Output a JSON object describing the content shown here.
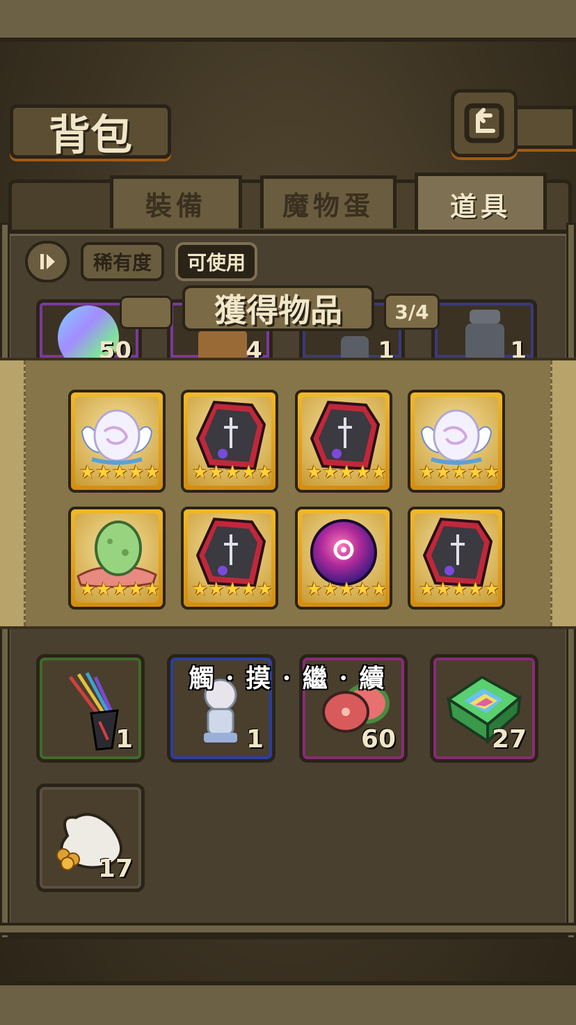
{
  "header": {
    "title": "背包"
  },
  "tabs": [
    {
      "label": "裝備",
      "active": false
    },
    {
      "label": "魔物蛋",
      "active": false
    },
    {
      "label": "道具",
      "active": true
    }
  ],
  "filters": {
    "rarity_label": "稀有度",
    "usable_label": "可使用"
  },
  "reward": {
    "title": "獲得物品",
    "page": "3/4",
    "continue_label": "觸 · 摸 · 繼 · 續",
    "items": [
      {
        "icon": "white-winged-egg-icon",
        "stars": "★★★★★"
      },
      {
        "icon": "coffin-card-icon",
        "stars": "★★★★★"
      },
      {
        "icon": "coffin-card-icon",
        "stars": "★★★★★"
      },
      {
        "icon": "white-winged-egg-icon",
        "stars": "★★★★★"
      },
      {
        "icon": "green-egg-icon",
        "stars": "★★★★★"
      },
      {
        "icon": "coffin-card-icon",
        "stars": "★★★★★"
      },
      {
        "icon": "purple-orb-icon",
        "stars": "★★★★★"
      },
      {
        "icon": "coffin-card-icon",
        "stars": "★★★★★"
      }
    ]
  },
  "inventory": {
    "top_partial": [
      {
        "icon": "rainbow-potion-icon",
        "count": "50",
        "rim": "#7a3a9a"
      },
      {
        "icon": "chest-icon",
        "count": "4",
        "rim": "#7a3a9a"
      },
      {
        "icon": "statue-icon",
        "count": "1",
        "rim": "#3a3a7a"
      },
      {
        "icon": "armored-statue-icon",
        "count": "1",
        "rim": "#3a3a7a"
      }
    ],
    "row": [
      {
        "icon": "arrows-quiver-icon",
        "count": "1",
        "rim": "#3f6a2a"
      },
      {
        "icon": "character-figure-icon",
        "count": "1",
        "rim": "#2b3fa0"
      },
      {
        "icon": "meat-slices-icon",
        "count": "60",
        "rim": "#8a2a7a"
      },
      {
        "icon": "rainbow-box-icon",
        "count": "27",
        "rim": "#8a2a7a"
      }
    ],
    "last": {
      "icon": "coin-bag-icon",
      "count": "17",
      "rim": "#5a5040"
    }
  },
  "colors": {
    "card_gold": "#f0b82a",
    "star": "#ffd23a",
    "accent_orange": "#a35a16"
  }
}
